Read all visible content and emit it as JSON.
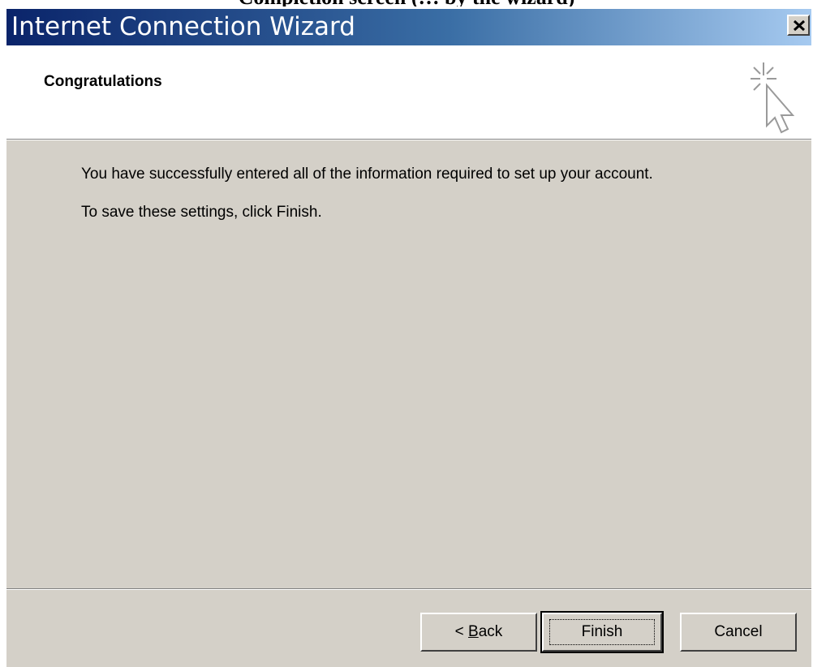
{
  "document": {
    "fragment_text": "Completion screen (… by the wizard)"
  },
  "window": {
    "title": "Internet Connection Wizard",
    "close_label": "×"
  },
  "header": {
    "title": "Congratulations",
    "icon": "wizard-cursor-sparkle-icon"
  },
  "body": {
    "line1": "You have successfully entered all of the information required to set up your account.",
    "line2": "To save these settings, click Finish."
  },
  "buttons": {
    "back_prefix": "< ",
    "back_mnemonic": "B",
    "back_rest": "ack",
    "finish": "Finish",
    "cancel": "Cancel"
  },
  "colors": {
    "titlebar_start": "#0a246a",
    "titlebar_end": "#a6caf0",
    "dialog_face": "#d4d0c8"
  }
}
